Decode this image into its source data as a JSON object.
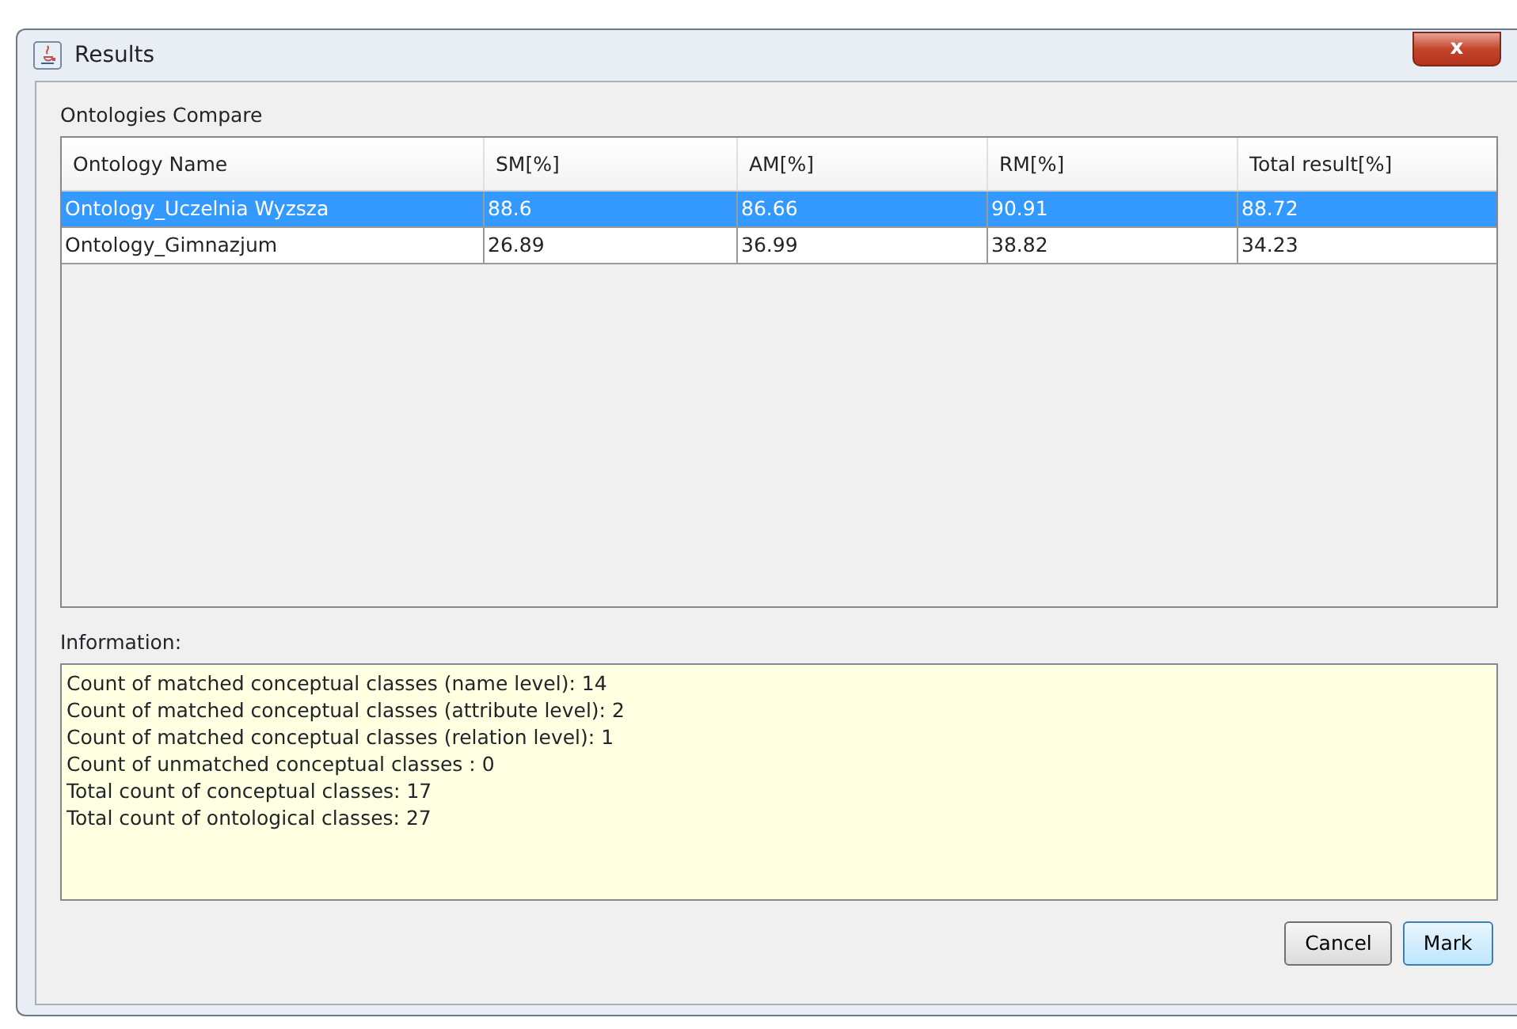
{
  "window": {
    "title": "Results",
    "close_label": "x"
  },
  "compare": {
    "label": "Ontologies Compare",
    "columns": [
      "Ontology Name",
      "SM[%]",
      "AM[%]",
      "RM[%]",
      "Total result[%]"
    ],
    "rows": [
      {
        "cells": [
          "Ontology_Uczelnia Wyzsza",
          "88.6",
          "86.66",
          "90.91",
          "88.72"
        ],
        "selected": true
      },
      {
        "cells": [
          "Ontology_Gimnazjum",
          "26.89",
          "36.99",
          "38.82",
          "34.23"
        ],
        "selected": false
      }
    ]
  },
  "information": {
    "label": "Information:",
    "lines": [
      "Count of matched conceptual classes (name level): 14",
      "Count of matched conceptual classes (attribute level): 2",
      "Count of matched conceptual classes (relation level): 1",
      "Count of unmatched conceptual classes : 0",
      "Total count of conceptual classes: 17",
      "Total count of ontological classes: 27"
    ]
  },
  "buttons": [
    {
      "label": "Cancel",
      "default": false
    },
    {
      "label": "Mark",
      "default": true
    }
  ]
}
